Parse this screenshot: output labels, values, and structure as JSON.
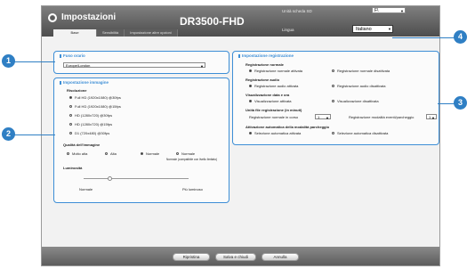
{
  "header": {
    "title": "Impostazioni",
    "model": "DR3500-FHD",
    "slot_label": "Unità scheda SD",
    "slot_value": "F\\",
    "language_label": "Lingua",
    "language_value": "Italiano"
  },
  "tabs": [
    "Base",
    "Sensibilità",
    "Impostazione altre opzioni"
  ],
  "timezone": {
    "title": "Fuso orario",
    "value": "Europe/London"
  },
  "video": {
    "title": "Impostazione immagine",
    "resolution_label": "Risoluzione",
    "resolutions": [
      "Full HD (1920x1080) @30fps",
      "Full HD (1920x1080) @15fps",
      "HD (1280x720) @30fps",
      "HD (1280x720) @15fps",
      "D1 (720x480) @30fps"
    ],
    "resolution_selected_index": 0,
    "quality_label": "Qualità dell'immagine",
    "qualities": [
      "Molto alta",
      "Alta",
      "Normale",
      "Normale"
    ],
    "quality_note": "Normale (compatibile con livello limitato)",
    "quality_selected_index": 2,
    "brightness_label": "Luminosità",
    "brightness_min": "Normale",
    "brightness_max": "Più luminoso",
    "brightness_level": 0.25
  },
  "record": {
    "title": "Impostazione registrazione",
    "normal_label": "Registrazione normale",
    "normal_on": "Registrazione normale attivata",
    "normal_off": "Registrazione normale disattivata",
    "audio_label": "Registrazione audio",
    "audio_on": "Registrazione audio attivata",
    "audio_off": "Registrazione audio disattivata",
    "speed_label": "Visualizzazione data e ora",
    "speed_on": "Visualizzazione attivata",
    "speed_off": "Visualizzazione disattivata",
    "unit_label": "Unità file registrazione (in minuti)",
    "continuous_label": "Registrazione normale in corso",
    "continuous_value": "1",
    "event_label": "Registrazione modalità eventi/parcheggio",
    "event_value": "1",
    "parking_label": "Attivazione automatica della modalità parcheggio",
    "parking_on": "Selezione automatica attivata",
    "parking_off": "Selezione automatica disattivata"
  },
  "footer": {
    "reset": "Ripristina",
    "save": "Salva e chiudi",
    "cancel": "Annulla"
  },
  "callouts": [
    "1",
    "2",
    "3",
    "4"
  ]
}
